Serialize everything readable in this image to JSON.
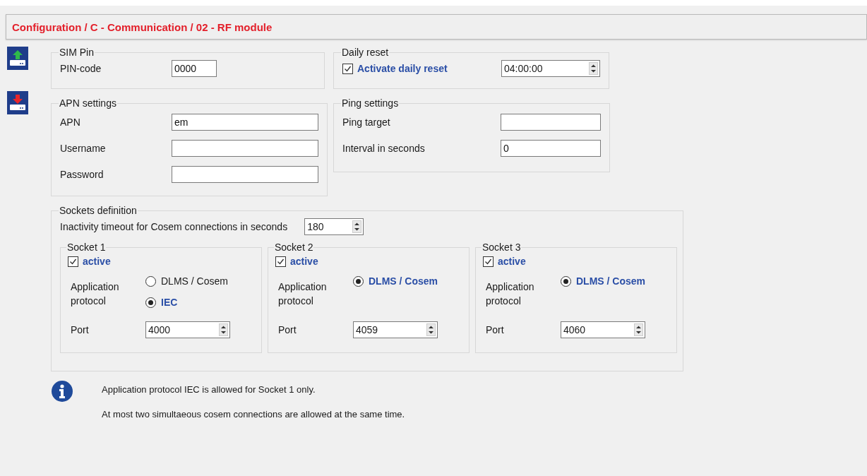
{
  "title": "Configuration / C - Communication / 02 - RF module",
  "sim_pin": {
    "legend": "SIM Pin",
    "fields": [
      {
        "label": "PIN-code",
        "value": "0000"
      }
    ]
  },
  "daily_reset": {
    "legend": "Daily reset",
    "checkbox": {
      "label": "Activate daily reset",
      "checked": true
    },
    "time": "04:00:00"
  },
  "apn_settings": {
    "legend": "APN settings",
    "fields": [
      {
        "label": "APN",
        "value": "em"
      },
      {
        "label": "Username"
      },
      {
        "label": "Password"
      }
    ]
  },
  "ping_settings": {
    "legend": "Ping settings",
    "fields": [
      {
        "label": "Ping target"
      },
      {
        "label": "Interval in seconds",
        "value": "0"
      }
    ]
  },
  "sockets": {
    "legend": "Sockets definition",
    "timeout_label": "Inactivity timeout for Cosem connections in seconds",
    "timeout": "180",
    "items": [
      {
        "legend": "Socket 1",
        "active": {
          "label": "active",
          "checked": true
        },
        "protocol_label": "Application protocol",
        "options": [
          {
            "label": "DLMS / Cosem",
            "selected": false
          },
          {
            "label": "IEC",
            "selected": true
          }
        ],
        "port_label": "Port",
        "port": "4000"
      },
      {
        "legend": "Socket 2",
        "active": {
          "label": "active",
          "checked": true
        },
        "protocol_label": "Application protocol",
        "options": [
          {
            "label": "DLMS / Cosem",
            "selected": true
          }
        ],
        "port_label": "Port",
        "port": "4059"
      },
      {
        "legend": "Socket 3",
        "active": {
          "label": "active",
          "checked": true
        },
        "protocol_label": "Application protocol",
        "options": [
          {
            "label": "DLMS / Cosem",
            "selected": true
          }
        ],
        "port_label": "Port",
        "port": "4060"
      }
    ]
  },
  "info": [
    "Application protocol IEC is allowed for Socket 1 only.",
    "At most two simultaeous cosem connections are allowed at the same time."
  ]
}
